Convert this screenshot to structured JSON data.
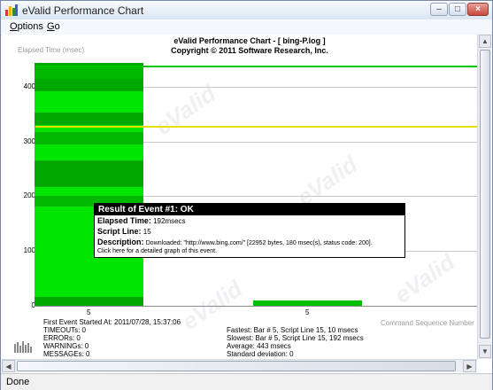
{
  "window": {
    "title": "eValid Performance Chart",
    "menu": [
      {
        "label": "Options",
        "accel": "O",
        "rest": "ptions"
      },
      {
        "label": "Go",
        "accel": "G",
        "rest": "o"
      }
    ]
  },
  "chart": {
    "title_line1": "eValid Performance Chart - [ bing-P.log ]",
    "title_line2": "Copyright © 2011 Software Research, Inc.",
    "y_axis_label": "Elapsed Time (msec)",
    "x_axis_label": "Command Sequence Number",
    "y_ticks": [
      "0",
      "100",
      "200",
      "300",
      "400"
    ],
    "x_ticks": [
      "5",
      "5"
    ],
    "watermark": "eValid",
    "colors": {
      "bar_bright": "#00e600",
      "bar_dark": "#00a800",
      "max_line": "#00c800",
      "avg_line": "#e6e000",
      "grid": "#c8c8c8"
    }
  },
  "chart_data": {
    "type": "bar",
    "categories": [
      "5",
      "5"
    ],
    "values": [
      443,
      10
    ],
    "reference_lines": [
      {
        "value": 443,
        "color": "#00c800"
      },
      {
        "value": 328,
        "color": "#e6e000"
      }
    ],
    "title": "eValid Performance Chart - [ bing-P.log ]",
    "subtitle": "Copyright © 2011 Software Research, Inc.",
    "xlabel": "Command Sequence Number",
    "ylabel": "Elapsed Time (msec)",
    "ylim": [
      0,
      450
    ],
    "grid": true
  },
  "popup": {
    "header": "Result of Event #1: OK",
    "elapsed_label": "Elapsed Time:",
    "elapsed_value": "192msecs",
    "script_label": "Script Line:",
    "script_value": "15",
    "description_label": "Description:",
    "description_value": "Downloaded: \"http://www.bing.com/\" [22952 bytes, 180 msec(s), status code: 200].",
    "link_text": "Click here for a detailed graph of this event."
  },
  "stats": {
    "first_event": "First Event Started At: 2011/07/28, 15:37:06",
    "timeouts": "TIMEOUTs: 0",
    "errors": "ERRORs: 0",
    "warnings": "WARNINGs: 0",
    "messages": "MESSAGEs: 0",
    "fastest": "Fastest: Bar # 5, Script Line 15, 10 msecs",
    "slowest": "Slowest: Bar # 5, Script Line 15, 192 msecs",
    "average": "Average: 443 msecs",
    "stddev": "Standard deviation: 0"
  },
  "status": {
    "text": "Done"
  }
}
